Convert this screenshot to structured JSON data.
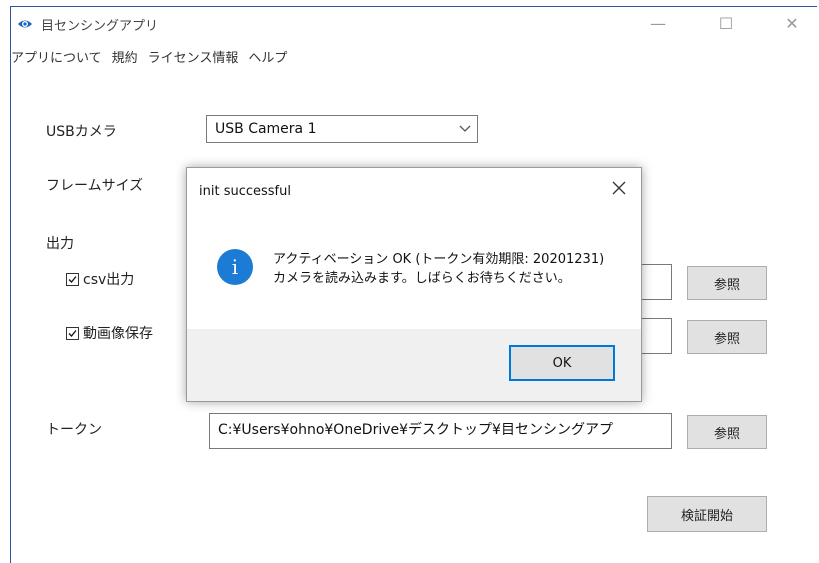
{
  "window": {
    "title": "目センシングアプリ",
    "minimize": "—",
    "maximize": "☐",
    "close": "✕"
  },
  "menu": [
    "アプリについて",
    "規約",
    "ライセンス情報",
    "ヘルプ"
  ],
  "form": {
    "camera_label": "USBカメラ",
    "camera_value": "USB Camera 1",
    "frame_label": "フレームサイズ",
    "output_label": "出力",
    "csv_label": "csv出力",
    "csv_checked": true,
    "video_label": "動画像保存",
    "video_checked": true,
    "browse1": "参照",
    "browse2": "参照",
    "token_label": "トークン",
    "token_value": "C:¥Users¥ohno¥OneDrive¥デスクトップ¥目センシングアプ",
    "browse3": "参照",
    "start_button": "検証開始"
  },
  "dialog": {
    "title": "init successful",
    "line1": "アクティベーション OK (トークン有効期限: 20201231)",
    "line2": "カメラを読み込みます。しばらくお待ちください。",
    "ok": "OK"
  },
  "colors": {
    "accent": "#0078d7",
    "info_icon": "#1c7bd4"
  }
}
